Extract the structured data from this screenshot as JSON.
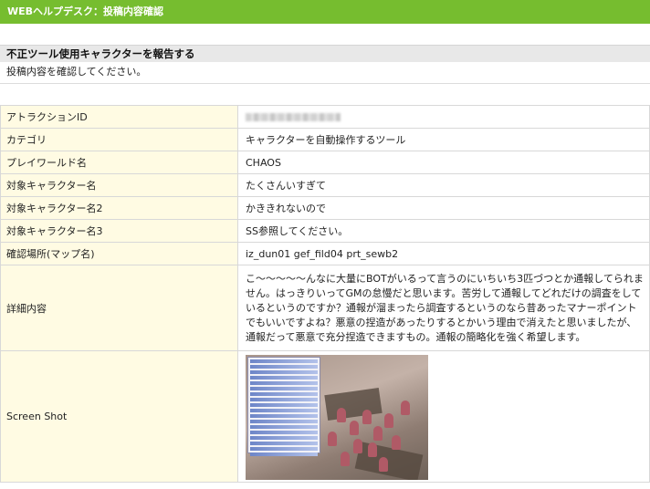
{
  "header": {
    "title": "WEBヘルプデスク：投稿内容確認"
  },
  "section": {
    "title": "不正ツール使用キャラクターを報告する",
    "note": "投稿内容を確認してください。"
  },
  "rows": [
    {
      "label": "アトラクションID",
      "value": ""
    },
    {
      "label": "カテゴリ",
      "value": "キャラクターを自動操作するツール"
    },
    {
      "label": "プレイワールド名",
      "value": "CHAOS"
    },
    {
      "label": "対象キャラクター名",
      "value": "たくさんいすぎて"
    },
    {
      "label": "対象キャラクター名2",
      "value": " かききれないので"
    },
    {
      "label": "対象キャラクター名3",
      "value": " SS参照してください。"
    },
    {
      "label": "確認場所(マップ名)",
      "value": " iz_dun01  gef_fild04  prt_sewb2"
    },
    {
      "label": "詳細内容",
      "value": " こ～～～～～んなに大量にBOTがいるって言うのにいちいち3匹づつとか通報してられません。はっきりいってGMの怠慢だと思います。苦労して通報してどれだけの調査をしているというのですか？通報が溜まったら調査するというのなら昔あったマナーポイントでもいいですよね？悪意の捏造があったりするとかいう理由で消えたと思いましたが、通報だって悪意で充分捏造できますもの。通報の簡略化を強く希望します。"
    },
    {
      "label": "Screen Shot",
      "value": ""
    }
  ],
  "icons": {
    "screenshot": "game-screenshot-image"
  }
}
